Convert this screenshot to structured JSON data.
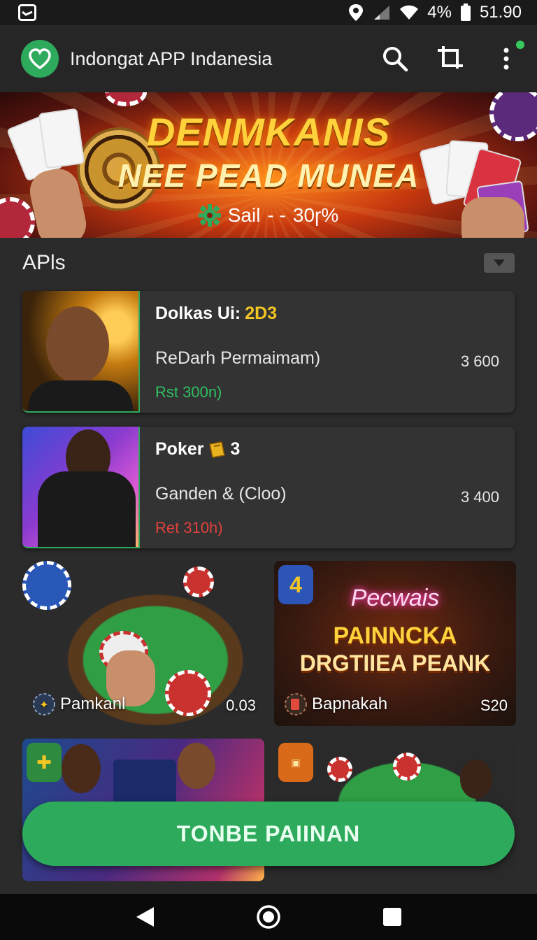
{
  "status_bar": {
    "battery_percent": "4%",
    "time": "51.90"
  },
  "app_bar": {
    "title": "Indongat APP Indanesia"
  },
  "banner": {
    "title_line1": "DENMKANIS",
    "title_line2": "NEE PEAD MUNEA",
    "sale_label": "Sail",
    "sale_sep": "- -",
    "sale_value": "30ɼ%"
  },
  "section": {
    "title": "APls"
  },
  "list": [
    {
      "title": "Dolkas Ui:",
      "title_accent": "2D3",
      "subtitle": "ReDarh Permaimam)",
      "price": "Rst 300n)",
      "count": "3 600"
    },
    {
      "title": "Poker",
      "title_accent": "3",
      "subtitle": "Ganden & (Cloo)",
      "price": "Ret 310h)",
      "count": "3 400"
    }
  ],
  "tiles": [
    {
      "label": "Pamkanl",
      "value": "0.03"
    },
    {
      "label": "Bapnakah",
      "value": "S20",
      "badge": "4",
      "sign1": "Pecwais",
      "sign2": "PAINNCKA",
      "sign3": "DRGTIIEA PEANK"
    },
    {
      "label": "",
      "value": ""
    },
    {
      "label": "",
      "value": ""
    }
  ],
  "cta": {
    "label": "TONBE PAIINAN"
  },
  "colors": {
    "accent_green": "#2eaa5c",
    "price_green": "#2fbf62",
    "price_red": "#e0423d",
    "gold": "#f3c623"
  }
}
